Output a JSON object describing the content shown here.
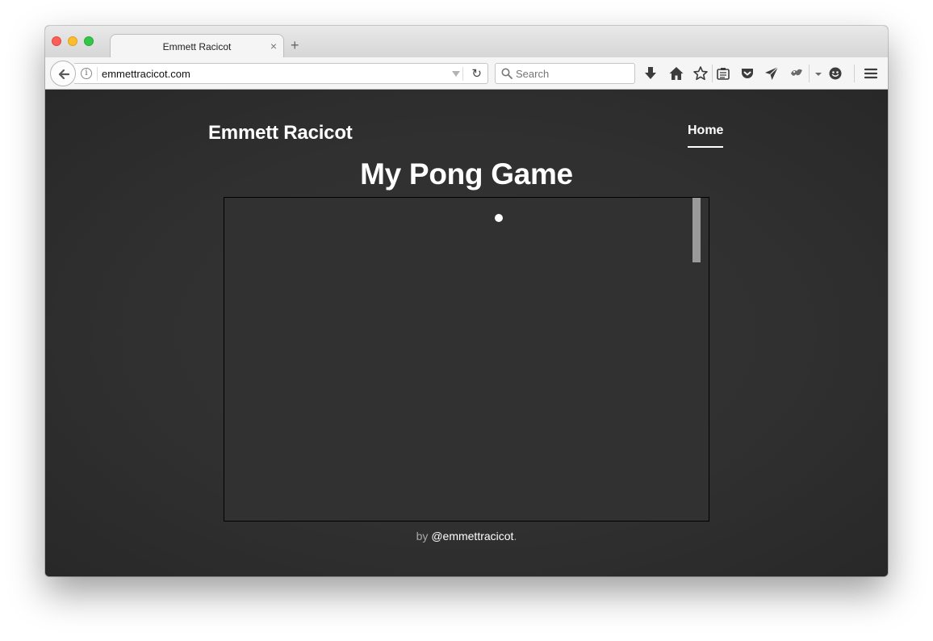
{
  "browser": {
    "tab": {
      "title": "Emmett Racicot",
      "close_label": "×"
    },
    "new_tab_label": "+",
    "url": "emmettracicot.com",
    "search": {
      "placeholder": "Search"
    },
    "reload_label": "↻"
  },
  "site": {
    "title": "Emmett Racicot",
    "nav": {
      "home": "Home"
    },
    "heading": "My Pong Game",
    "footer": {
      "by": "by ",
      "handle": "@emmettracicot",
      "period": "."
    }
  },
  "game": {
    "ball_color": "#ffffff",
    "paddle_color": "#9a9a9a",
    "background": "#313131"
  },
  "colors": {
    "page_bg": "#303030",
    "text": "#ffffff",
    "footer_muted": "#a8a8a8"
  },
  "toolbar_icons": [
    "download-icon",
    "home-icon",
    "bookmark-star-icon",
    "reading-list-icon",
    "pocket-icon",
    "send-tab-icon",
    "extension-icon",
    "menu-dropdown-icon",
    "emoji-icon",
    "hamburger-menu-icon"
  ]
}
